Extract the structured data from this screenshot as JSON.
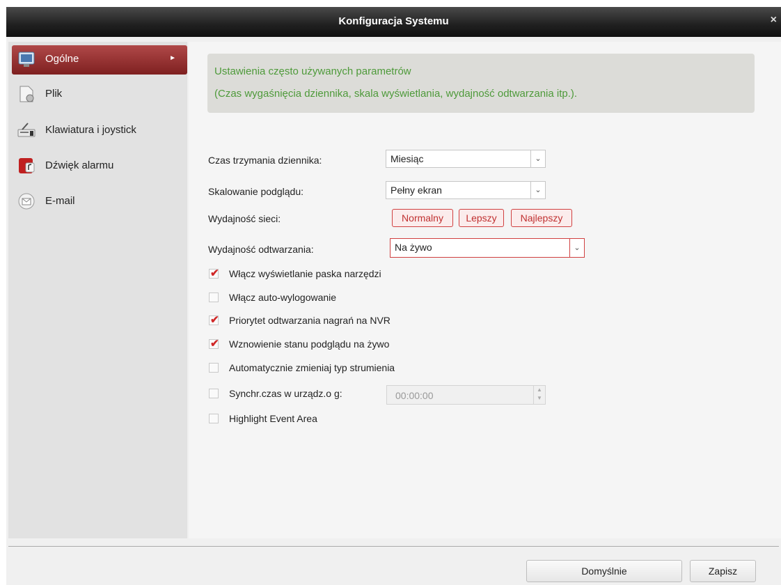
{
  "window": {
    "title": "Konfiguracja Systemu",
    "close_glyph": "×"
  },
  "sidebar": {
    "items": [
      {
        "label": "Ogólne",
        "icon": "general-settings-icon",
        "active": true,
        "arrow": "►"
      },
      {
        "label": "Plik",
        "icon": "file-icon",
        "active": false
      },
      {
        "label": "Klawiatura i joystick",
        "icon": "keyboard-joystick-icon",
        "active": false
      },
      {
        "label": "Dźwięk alarmu",
        "icon": "alarm-sound-icon",
        "active": false
      },
      {
        "label": "E-mail",
        "icon": "email-icon",
        "active": false
      }
    ]
  },
  "info": {
    "line1": "Ustawienia często używanych parametrów",
    "line2": "(Czas wygaśnięcia dziennika, skala wyświetlania, wydajność odtwarzania itp.)."
  },
  "form": {
    "log_retention": {
      "label": "Czas trzymania dziennika:",
      "value": "Miesiąc"
    },
    "preview_scaling": {
      "label": "Skalowanie podglądu:",
      "value": "Pełny ekran"
    },
    "network_performance": {
      "label": "Wydajność sieci:",
      "options": [
        "Normalny",
        "Lepszy",
        "Najlepszy"
      ]
    },
    "playback_performance": {
      "label": "Wydajność odtwarzania:",
      "value": "Na żywo"
    },
    "checkboxes": [
      {
        "label": "Włącz wyświetlanie paska narzędzi",
        "checked": true
      },
      {
        "label": "Włącz auto-wylogowanie",
        "checked": false
      },
      {
        "label": "Priorytet odtwarzania nagrań na NVR",
        "checked": true
      },
      {
        "label": "Wznowienie stanu podglądu na żywo",
        "checked": true
      },
      {
        "label": "Automatycznie zmieniaj typ strumienia",
        "checked": false
      },
      {
        "label": "Synchr.czas w urządz.o g:",
        "checked": false
      },
      {
        "label": "Highlight Event Area",
        "checked": false
      }
    ],
    "sync_time": {
      "value": "00:00:00"
    }
  },
  "footer": {
    "default_label": "Domyślnie",
    "save_label": "Zapisz"
  },
  "colors": {
    "accent_red": "#8e2a2a",
    "info_green": "#4e9a3a",
    "check_red": "#d02828"
  }
}
